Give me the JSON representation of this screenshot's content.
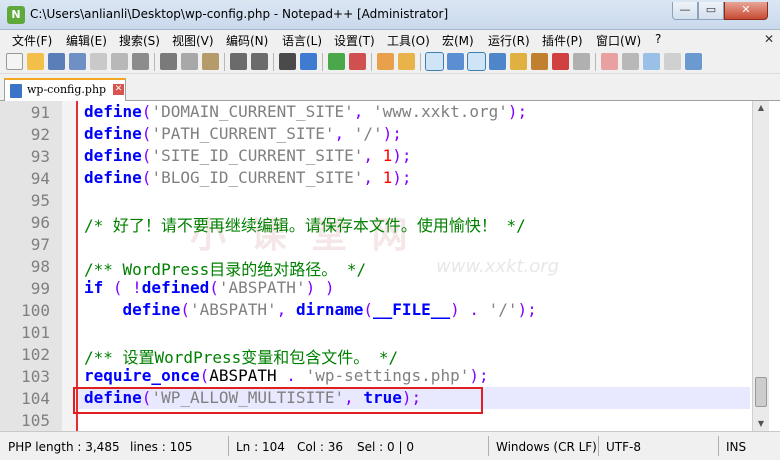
{
  "window": {
    "title": "C:\\Users\\anlianli\\Desktop\\wp-config.php - Notepad++ [Administrator]",
    "min_glyph": "—",
    "max_glyph": "▭",
    "close_glyph": "✕"
  },
  "menu": {
    "items": [
      "文件(F)",
      "编辑(E)",
      "搜索(S)",
      "视图(V)",
      "编码(N)",
      "语言(L)",
      "设置(T)",
      "工具(O)",
      "宏(M)",
      "运行(R)",
      "插件(P)",
      "窗口(W)",
      "?"
    ],
    "close_glyph": "✕"
  },
  "tab": {
    "label": "wp-config.php",
    "close_glyph": "✕"
  },
  "editor": {
    "lines": [
      {
        "num": "91",
        "tokens": [
          {
            "t": "kw",
            "v": "define"
          },
          {
            "t": "op",
            "v": "("
          },
          {
            "t": "str",
            "v": "'DOMAIN_CURRENT_SITE'"
          },
          {
            "t": "op",
            "v": ", "
          },
          {
            "t": "str",
            "v": "'www.xxkt.org'"
          },
          {
            "t": "op",
            "v": ");"
          }
        ]
      },
      {
        "num": "92",
        "tokens": [
          {
            "t": "kw",
            "v": "define"
          },
          {
            "t": "op",
            "v": "("
          },
          {
            "t": "str",
            "v": "'PATH_CURRENT_SITE'"
          },
          {
            "t": "op",
            "v": ", "
          },
          {
            "t": "str",
            "v": "'/'"
          },
          {
            "t": "op",
            "v": ");"
          }
        ]
      },
      {
        "num": "93",
        "tokens": [
          {
            "t": "kw",
            "v": "define"
          },
          {
            "t": "op",
            "v": "("
          },
          {
            "t": "str",
            "v": "'SITE_ID_CURRENT_SITE'"
          },
          {
            "t": "op",
            "v": ", "
          },
          {
            "t": "num",
            "v": "1"
          },
          {
            "t": "op",
            "v": ");"
          }
        ]
      },
      {
        "num": "94",
        "tokens": [
          {
            "t": "kw",
            "v": "define"
          },
          {
            "t": "op",
            "v": "("
          },
          {
            "t": "str",
            "v": "'BLOG_ID_CURRENT_SITE'"
          },
          {
            "t": "op",
            "v": ", "
          },
          {
            "t": "num",
            "v": "1"
          },
          {
            "t": "op",
            "v": ");"
          }
        ]
      },
      {
        "num": "95",
        "tokens": []
      },
      {
        "num": "96",
        "tokens": [
          {
            "t": "cmt",
            "v": "/* 好了！请不要再继续编辑。请保存本文件。使用愉快！ */"
          }
        ]
      },
      {
        "num": "97",
        "tokens": []
      },
      {
        "num": "98",
        "tokens": [
          {
            "t": "cmt",
            "v": "/** WordPress目录的绝对路径。 */"
          }
        ]
      },
      {
        "num": "99",
        "tokens": [
          {
            "t": "kw",
            "v": "if"
          },
          {
            "t": "op",
            "v": " ( !"
          },
          {
            "t": "kw",
            "v": "defined"
          },
          {
            "t": "op",
            "v": "("
          },
          {
            "t": "str",
            "v": "'ABSPATH'"
          },
          {
            "t": "op",
            "v": ") )"
          }
        ]
      },
      {
        "num": "100",
        "tokens": [
          {
            "t": "plain",
            "v": "    "
          },
          {
            "t": "kw",
            "v": "define"
          },
          {
            "t": "op",
            "v": "("
          },
          {
            "t": "str",
            "v": "'ABSPATH'"
          },
          {
            "t": "op",
            "v": ", "
          },
          {
            "t": "kw",
            "v": "dirname"
          },
          {
            "t": "op",
            "v": "("
          },
          {
            "t": "kw",
            "v": "__FILE__"
          },
          {
            "t": "op",
            "v": ") . "
          },
          {
            "t": "str",
            "v": "'/'"
          },
          {
            "t": "op",
            "v": ");"
          }
        ]
      },
      {
        "num": "101",
        "tokens": []
      },
      {
        "num": "102",
        "tokens": [
          {
            "t": "cmt",
            "v": "/** 设置WordPress变量和包含文件。 */"
          }
        ]
      },
      {
        "num": "103",
        "tokens": [
          {
            "t": "kw",
            "v": "require_once"
          },
          {
            "t": "op",
            "v": "("
          },
          {
            "t": "plain",
            "v": "ABSPATH"
          },
          {
            "t": "op",
            "v": " . "
          },
          {
            "t": "str",
            "v": "'wp-settings.php'"
          },
          {
            "t": "op",
            "v": ");"
          }
        ]
      },
      {
        "num": "104",
        "tokens": [
          {
            "t": "kw",
            "v": "define"
          },
          {
            "t": "op",
            "v": "("
          },
          {
            "t": "str",
            "v": "'WP_ALLOW_MULTISITE'"
          },
          {
            "t": "op",
            "v": ", "
          },
          {
            "t": "kw",
            "v": "true"
          },
          {
            "t": "op",
            "v": ");"
          }
        ]
      },
      {
        "num": "105",
        "tokens": []
      }
    ]
  },
  "watermark": {
    "main": "小 课 堂 网",
    "sub": "www.xxkt.org"
  },
  "status": {
    "file_type": "PHP length : 3,485",
    "lines": "lines : 105",
    "ln": "Ln : 104",
    "col": "Col : 36",
    "sel": "Sel : 0 | 0",
    "eol": "Windows (CR LF)",
    "encoding": "UTF-8",
    "mode": "INS"
  },
  "colors": {
    "keyword": "#0000ff",
    "string": "#808080",
    "number": "#ff0000",
    "operator": "#8000ff",
    "comment": "#008000",
    "highlight_box": "#e02020"
  }
}
